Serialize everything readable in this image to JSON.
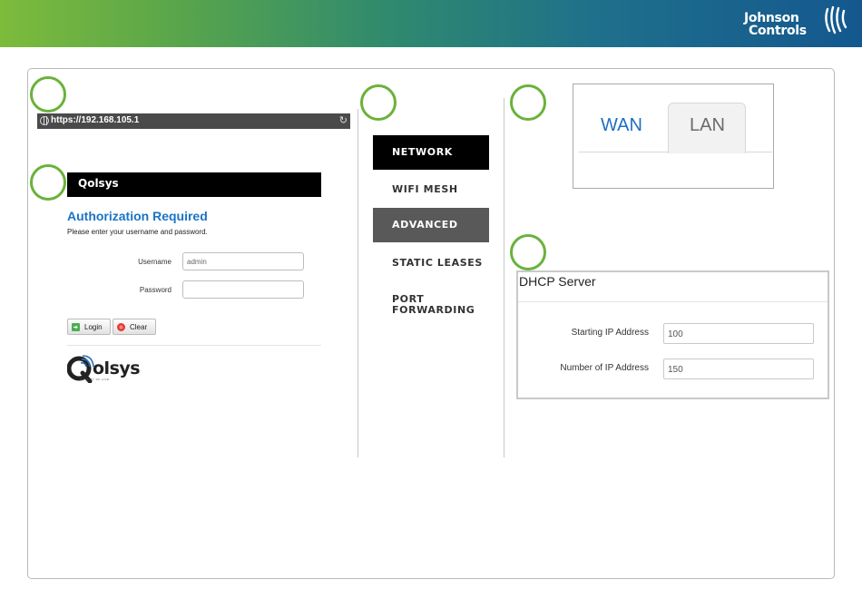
{
  "brand": {
    "line1": "Johnson",
    "line2": "Controls"
  },
  "browser": {
    "url": "https://192.168.105.1"
  },
  "login": {
    "logo": "Qolsys",
    "title": "Authorization Required",
    "subtitle": "Please enter your username and password.",
    "username_label": "Username",
    "username_value": "admin",
    "password_label": "Password",
    "password_value": "",
    "login_button": "Login",
    "clear_button": "Clear",
    "footer_logo": "olsys",
    "footer_tagline": "QUALITY OF LIFE"
  },
  "menu": {
    "items": [
      {
        "label": "NETWORK",
        "state": "active"
      },
      {
        "label": "WIFI MESH",
        "state": "normal"
      },
      {
        "label": "ADVANCED",
        "state": "highlighted"
      },
      {
        "label": "STATIC LEASES",
        "state": "normal"
      },
      {
        "label": "PORT FORWARDING",
        "state": "normal"
      }
    ]
  },
  "tabs": {
    "wan": "WAN",
    "lan": "LAN",
    "selected": "LAN"
  },
  "dhcp": {
    "title": "DHCP Server",
    "start_label": "Starting IP Address",
    "start_value": "100",
    "count_label": "Number of IP Address",
    "count_value": "150"
  },
  "colors": {
    "step_circle": "#6ab23a",
    "link_blue": "#1a73c6",
    "menu_active": "#000000",
    "menu_highlight": "#595959"
  }
}
